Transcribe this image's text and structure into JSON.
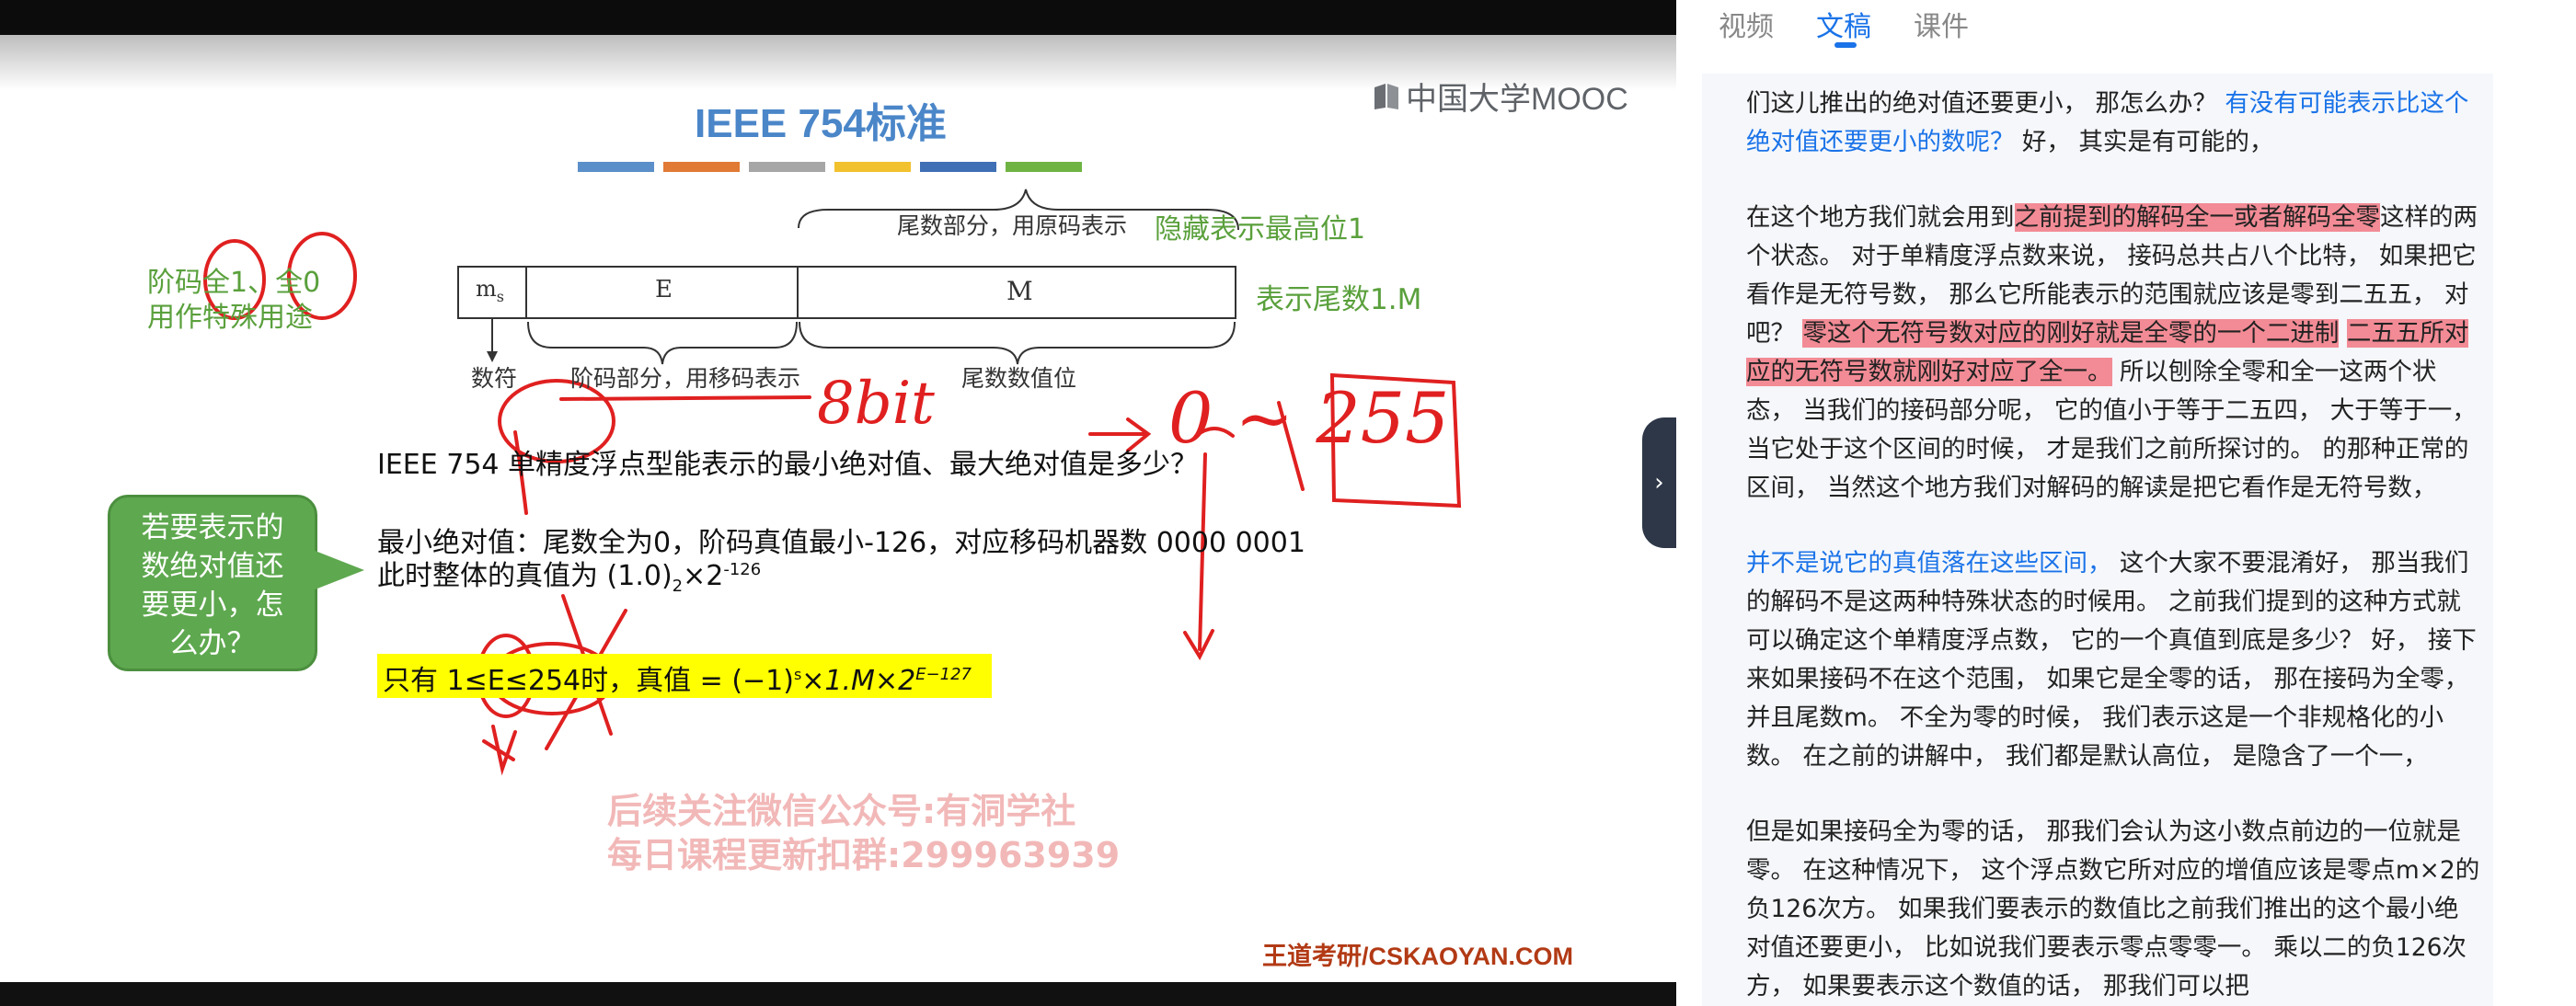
{
  "slide": {
    "title": "IEEE 754标准",
    "logo": "中国大学MOOC",
    "color_bar": [
      "#5b8fc9",
      "#e07a35",
      "#a6a6a6",
      "#f2c12e",
      "#3f6fb5",
      "#6fb443"
    ],
    "mantissa_note": "尾数部分，用原码表示",
    "hidden_bit_note": "隐藏表示最高位1",
    "field_ms": "m",
    "field_ms_sub": "s",
    "field_e": "E",
    "field_m": "M",
    "label_sign": "数符",
    "label_exponent": "阶码部分，用移码表示",
    "label_mantissa_value": "尾数数值位",
    "represent_note": "表示尾数1.M",
    "special_note_line1": "阶码全1、全0",
    "special_note_line2": "用作特殊用途",
    "question": "IEEE 754 单精度浮点型能表示的最小绝对值、最大绝对值是多少？",
    "min_abs_line1": "最小绝对值：尾数全为0，阶码真值最小-126，对应移码机器数 0000 0001",
    "min_abs_line2_prefix": "此时整体的真值为 (1.0)",
    "min_abs_line2_sub": "2",
    "min_abs_line2_times": "×2",
    "min_abs_line2_exp": "-126",
    "only_when_prefix": "只有 1≤E≤254时，真值 = (−1)",
    "only_when_s": "s",
    "only_when_mid": "×1.M×2",
    "only_when_exp": "E−127",
    "callout": [
      "若要表示的",
      "数绝对值还",
      "要更小，怎",
      "么办？"
    ],
    "hand_8bit": "8bit",
    "hand_range": "0 ~ 255",
    "watermark_line1": "后续关注微信公众号:有洞学社",
    "watermark_line2": "每日课程更新扣群:299963939",
    "footer": "王道考研/CSKAOYAN.COM"
  },
  "expand_icon": "chevron-right-icon",
  "tabs": [
    {
      "label": "视频",
      "active": false
    },
    {
      "label": "文稿",
      "active": true
    },
    {
      "label": "课件",
      "active": false
    }
  ],
  "transcript": {
    "p1_a": "们这儿推出的绝对值还要更小，  那怎么办？  ",
    "p1_b": "有没有可能表示比这个绝对值还要更小的数呢？",
    "p1_c": "  好，  其实是有可能的，",
    "p2_a": "在这个地方我们就会用到",
    "p2_b": "之前提到的解码全一或者解码全零",
    "p2_c": "这样的两个状态。  对于单精度浮点数来说，  接码总共占八个比特，  如果把它看作是无符号数，  那么它所能表示的范围就应该是零到二五五，  对吧？  ",
    "p2_d": "零这个无符号数对应的刚好就是全零的一个二进制",
    "p2_e": " ",
    "p2_f": "二五五所对应的无符号数就刚好对应了全一。",
    "p2_g": "  所以刨除全零和全一这两个状态，  当我们的接码部分呢，  它的值小于等于二五四，  大于等于一，  当它处于这个区间的时候，  才是我们之前所探讨的。  的那种正常的区间，  当然这个地方我们对解码的解读是把它看作是无符号数，",
    "p3_a": "并不是说它的真值落在这些区间，",
    "p3_b": "  这个大家不要混淆好，  那当我们的解码不是这两种特殊状态的时候用。  之前我们提到的这种方式就可以确定这个单精度浮点数，  它的一个真值到底是多少？  好，  接下来如果接码不在这个范围，  如果它是全零的话，  那在接码为全零，  并且尾数m。  不全为零的时候，  我们表示这是一个非规格化的小数。  在之前的讲解中，  我们都是默认高位，  是隐含了一个一，",
    "p4": "但是如果接码全为零的话，  那我们会认为这小数点前边的一位就是零。  在这种情况下，  这个浮点数它所对应的增值应该是零点m×2的负126次方。  如果我们要表示的数值比之前我们推出的这个最小绝对值还要更小，  比如说我们要表示零点零零一。  乘以二的负126次方，  如果要表示这个数值的话，  那我们可以把"
  }
}
